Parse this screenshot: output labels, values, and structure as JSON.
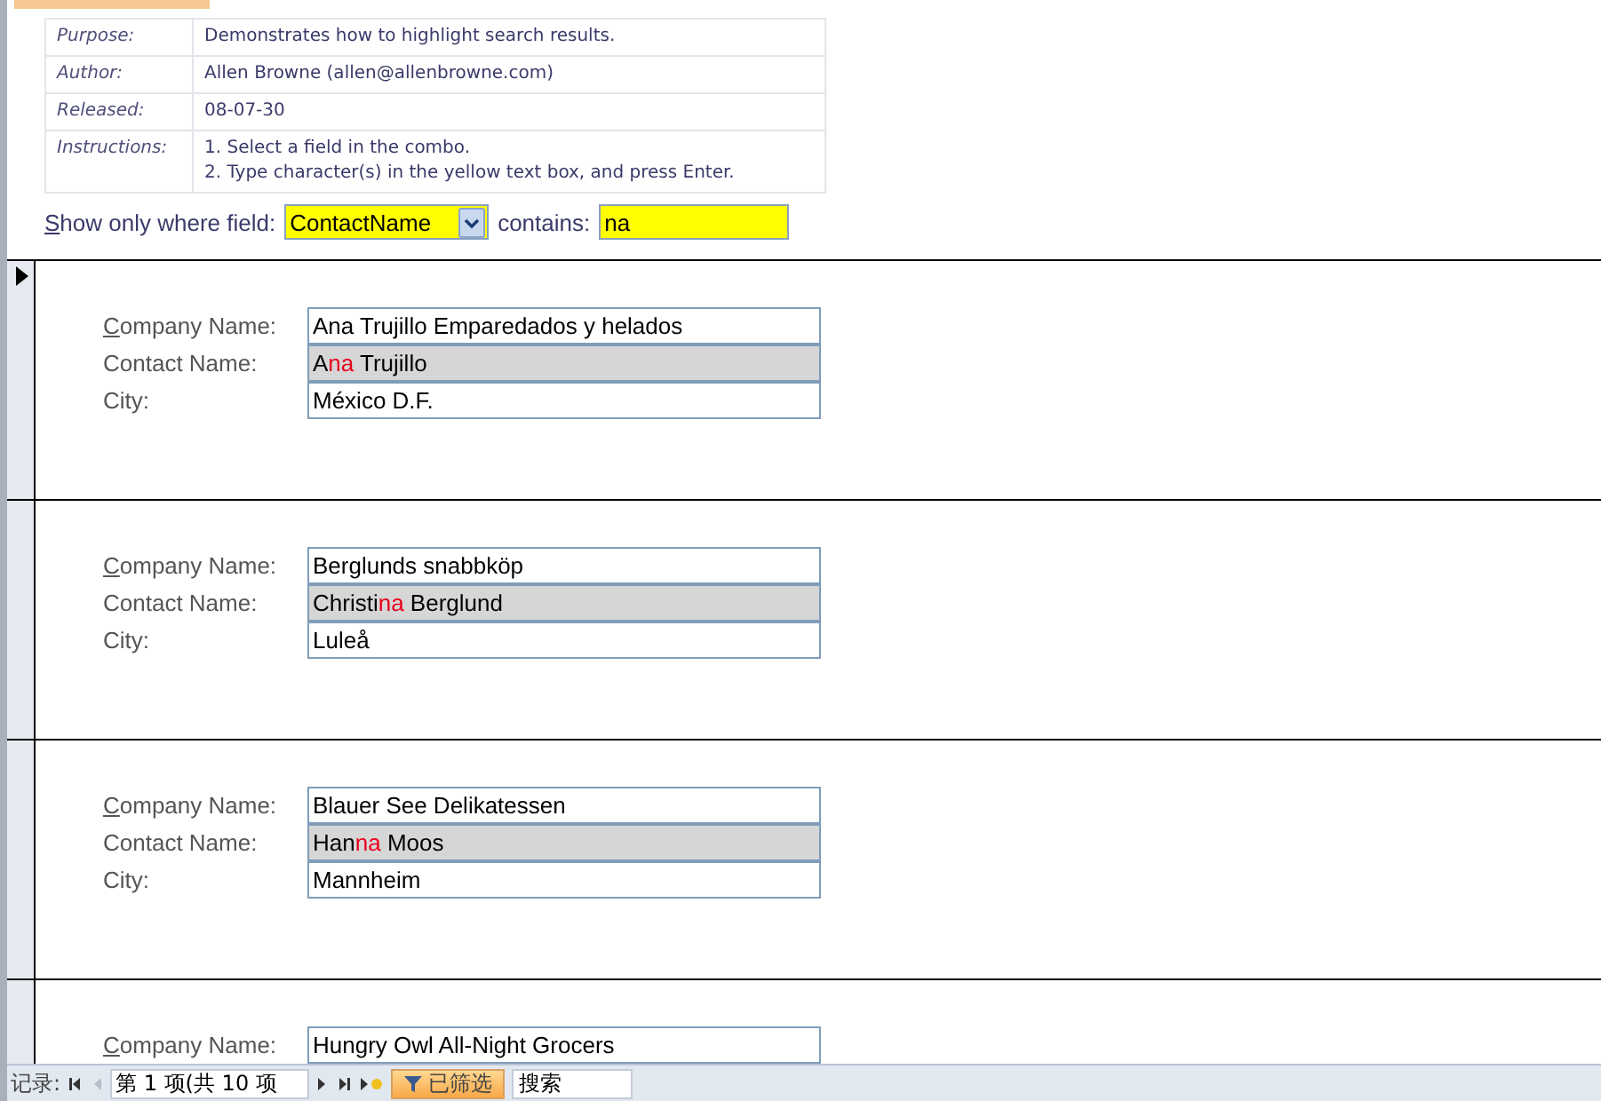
{
  "info": [
    {
      "label": "Purpose:",
      "lines": [
        "Demonstrates how to highlight search results."
      ]
    },
    {
      "label": "Author:",
      "lines": [
        "Allen Browne (allen@allenbrowne.com)"
      ]
    },
    {
      "label": "Released:",
      "lines": [
        "08-07-30"
      ]
    },
    {
      "label": "Instructions:",
      "lines": [
        "1. Select a field in the combo.",
        "2. Type character(s) in the yellow text box, and press Enter."
      ]
    }
  ],
  "filter": {
    "label": "Show only where field:",
    "field": "ContactName",
    "contains_label": "contains:",
    "contains": "na"
  },
  "records": [
    {
      "selected": true,
      "fields": [
        {
          "label": "Company Name:",
          "access_key": true,
          "shaded": false,
          "parts": [
            {
              "text": "Ana Trujillo Emparedados y helados",
              "match": false
            }
          ]
        },
        {
          "label": "Contact Name:",
          "access_key": false,
          "shaded": true,
          "parts": [
            {
              "text": "A",
              "match": false
            },
            {
              "text": "na",
              "match": true
            },
            {
              "text": " Trujillo",
              "match": false
            }
          ]
        },
        {
          "label": "City:",
          "access_key": false,
          "shaded": false,
          "parts": [
            {
              "text": "México D.F.",
              "match": false
            }
          ]
        }
      ]
    },
    {
      "selected": false,
      "fields": [
        {
          "label": "Company Name:",
          "access_key": true,
          "shaded": false,
          "parts": [
            {
              "text": "Berglunds snabbköp",
              "match": false
            }
          ]
        },
        {
          "label": "Contact Name:",
          "access_key": false,
          "shaded": true,
          "parts": [
            {
              "text": "Christi",
              "match": false
            },
            {
              "text": "na",
              "match": true
            },
            {
              "text": " Berglund",
              "match": false
            }
          ]
        },
        {
          "label": "City:",
          "access_key": false,
          "shaded": false,
          "parts": [
            {
              "text": "Luleå",
              "match": false
            }
          ]
        }
      ]
    },
    {
      "selected": false,
      "fields": [
        {
          "label": "Company Name:",
          "access_key": true,
          "shaded": false,
          "parts": [
            {
              "text": "Blauer See Delikatessen",
              "match": false
            }
          ]
        },
        {
          "label": "Contact Name:",
          "access_key": false,
          "shaded": true,
          "parts": [
            {
              "text": "Han",
              "match": false
            },
            {
              "text": "na",
              "match": true
            },
            {
              "text": " Moos",
              "match": false
            }
          ]
        },
        {
          "label": "City:",
          "access_key": false,
          "shaded": false,
          "parts": [
            {
              "text": "Mannheim",
              "match": false
            }
          ]
        }
      ]
    },
    {
      "selected": false,
      "fields": [
        {
          "label": "Company Name:",
          "access_key": true,
          "shaded": false,
          "parts": [
            {
              "text": "Hungry Owl All-Night Grocers",
              "match": false
            }
          ]
        }
      ]
    }
  ],
  "nav": {
    "label": "记录:",
    "position": "第 1 项(共 10 项",
    "prev_disabled": true,
    "filter_label": "已筛选",
    "filtered": true,
    "search_placeholder": "搜索"
  }
}
